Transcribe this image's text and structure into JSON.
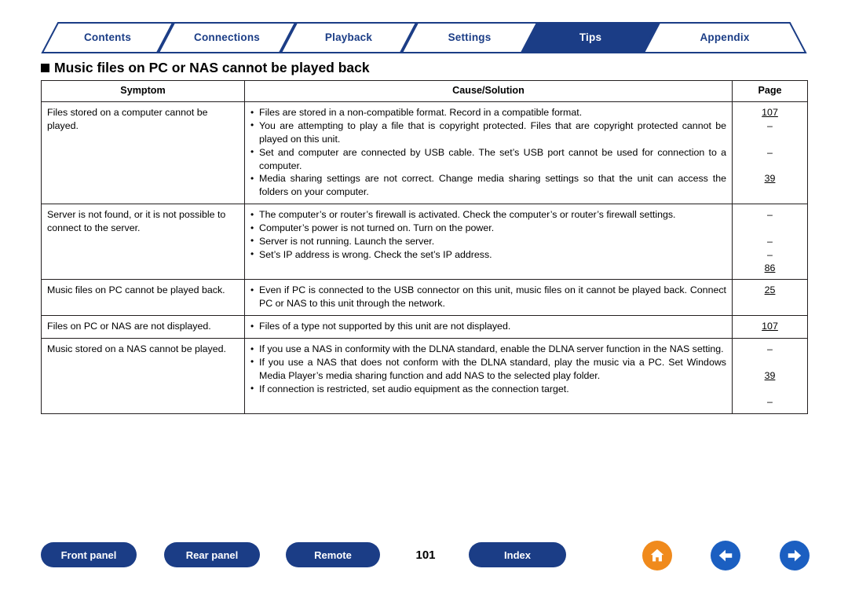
{
  "tabs": [
    {
      "label": "Contents",
      "active": false
    },
    {
      "label": "Connections",
      "active": false
    },
    {
      "label": "Playback",
      "active": false
    },
    {
      "label": "Settings",
      "active": false
    },
    {
      "label": "Tips",
      "active": true
    },
    {
      "label": "Appendix",
      "active": false
    }
  ],
  "heading": "Music files on PC or NAS cannot be played back",
  "table": {
    "headers": {
      "symptom": "Symptom",
      "cause": "Cause/Solution",
      "page": "Page"
    },
    "rows": [
      {
        "symptom": "Files stored on a computer cannot be played.",
        "causes": [
          "Files are stored in a non-compatible format. Record in a compatible format.",
          "You are attempting to play a file that is copyright protected. Files that are copyright protected cannot be played on this unit.",
          "Set and computer are connected by USB cable. The set’s USB port cannot be used for connection to a computer.",
          "Media sharing settings are not correct. Change media sharing settings so that the unit can access the folders on your computer."
        ],
        "pages": [
          {
            "text": "107",
            "link": true,
            "offset": 0
          },
          {
            "text": "–",
            "link": false,
            "offset": 1
          },
          {
            "text": "–",
            "link": false,
            "offset": 1
          },
          {
            "text": "39",
            "link": true,
            "offset": 1
          }
        ]
      },
      {
        "symptom": "Server is not found, or it is not possible to connect to the server.",
        "causes": [
          "The computer’s or router’s firewall is activated. Check the computer’s or router’s firewall settings.",
          "Computer’s power is not turned on. Turn on the power.",
          "Server is not running. Launch the server.",
          "Set’s IP address is wrong. Check the set’s IP address."
        ],
        "pages": [
          {
            "text": "–",
            "link": false,
            "offset": 0
          },
          {
            "text": "–",
            "link": false,
            "offset": 1
          },
          {
            "text": "–",
            "link": false,
            "offset": 0
          },
          {
            "text": "86",
            "link": true,
            "offset": 0
          }
        ]
      },
      {
        "symptom": "Music files on PC cannot be played back.",
        "causes": [
          "Even if PC is connected to the USB connector on this unit, music files on it cannot be played back. Connect PC or NAS to this unit through the network."
        ],
        "pages": [
          {
            "text": "25",
            "link": true,
            "offset": 0
          }
        ]
      },
      {
        "symptom": "Files on PC or NAS are not displayed.",
        "causes": [
          "Files of a type not supported by this unit are not displayed."
        ],
        "pages": [
          {
            "text": "107",
            "link": true,
            "offset": 0
          }
        ]
      },
      {
        "symptom": "Music stored on a NAS cannot be played.",
        "causes": [
          "If you use a NAS in conformity with the DLNA standard, enable the DLNA server function in the NAS setting.",
          "If you use a NAS that does not conform with the DLNA standard, play the music via a PC. Set Windows Media Player’s media sharing function and add NAS to the selected play folder.",
          "If connection is restricted, set audio equipment as the connection target."
        ],
        "pages": [
          {
            "text": "–",
            "link": false,
            "offset": 0
          },
          {
            "text": "39",
            "link": true,
            "offset": 1
          },
          {
            "text": "–",
            "link": false,
            "offset": 1
          }
        ]
      }
    ]
  },
  "footer": {
    "buttons": [
      {
        "label": "Front panel"
      },
      {
        "label": "Rear panel"
      },
      {
        "label": "Remote"
      },
      {
        "label": "Index"
      }
    ],
    "page_number": "101",
    "icons": [
      {
        "name": "home-icon",
        "glyph": "home"
      },
      {
        "name": "back-arrow-icon",
        "glyph": "left"
      },
      {
        "name": "forward-arrow-icon",
        "glyph": "right"
      }
    ]
  }
}
